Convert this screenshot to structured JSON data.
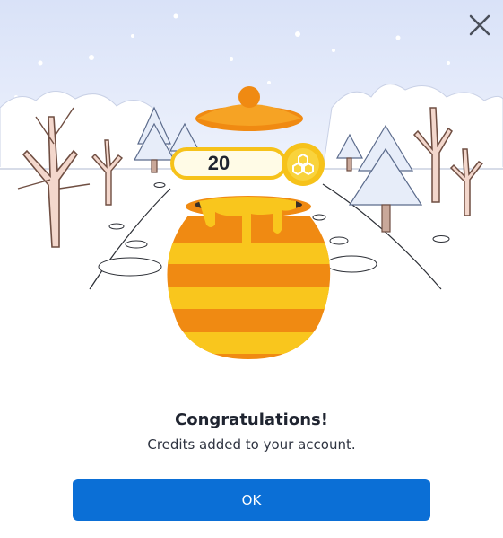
{
  "dialog": {
    "close_icon": "close-icon",
    "credits": {
      "value": "20",
      "icon": "honeycomb-coin-icon"
    },
    "title": "Congratulations!",
    "subtitle": "Credits added to your account.",
    "ok_label": "OK"
  },
  "colors": {
    "accent": "#0b6fd6",
    "honey": "#f6c21a",
    "pot_orange": "#f29a1c",
    "sky": "#e6ecfa"
  }
}
